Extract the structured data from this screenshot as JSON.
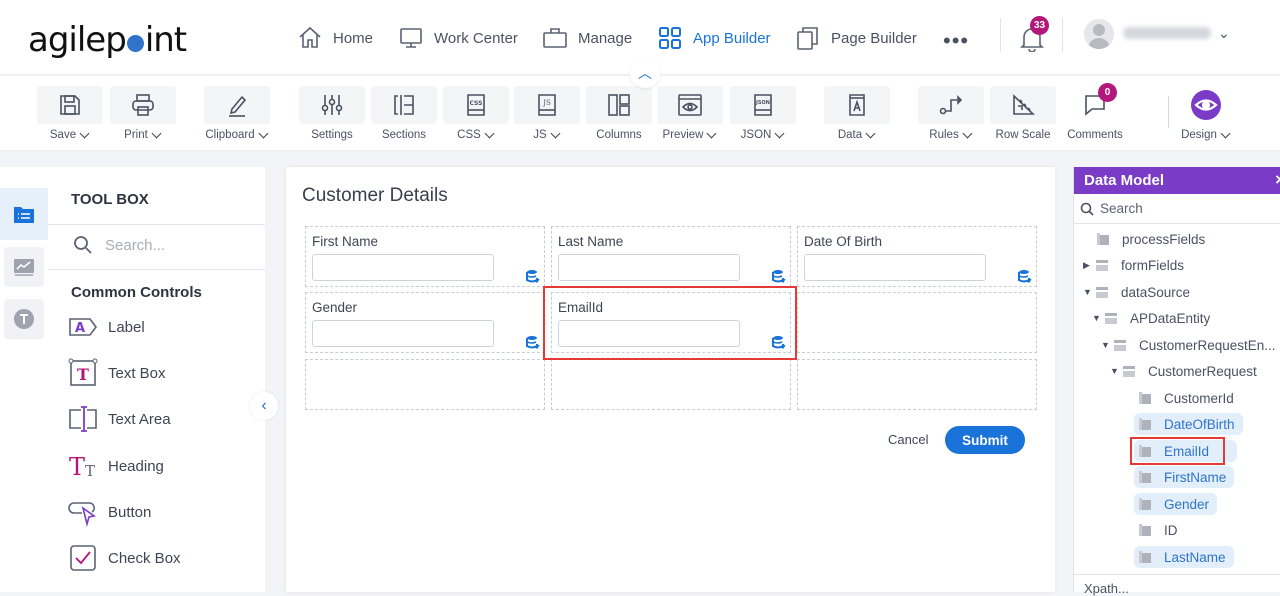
{
  "brand": {
    "logo_pre": "agilep",
    "logo_post": "int"
  },
  "nav": {
    "items": [
      {
        "label": "Home",
        "icon": "home-icon"
      },
      {
        "label": "Work Center",
        "icon": "monitor-icon"
      },
      {
        "label": "Manage",
        "icon": "briefcase-icon"
      },
      {
        "label": "App Builder",
        "icon": "grid-icon",
        "active": true
      },
      {
        "label": "Page Builder",
        "icon": "pages-icon"
      }
    ],
    "more": "•••",
    "notifications_count": "33",
    "user_chevron": "⌄"
  },
  "toolbar": {
    "items": [
      {
        "label": "Save",
        "dropdown": true
      },
      {
        "label": "Print",
        "dropdown": true
      },
      {
        "label": "Clipboard",
        "dropdown": true
      },
      {
        "label": "Settings",
        "dropdown": false
      },
      {
        "label": "Sections",
        "dropdown": false
      },
      {
        "label": "CSS",
        "dropdown": true
      },
      {
        "label": "JS",
        "dropdown": true
      },
      {
        "label": "Columns",
        "dropdown": false
      },
      {
        "label": "Preview",
        "dropdown": true
      },
      {
        "label": "JSON",
        "dropdown": true
      },
      {
        "label": "Data",
        "dropdown": true
      },
      {
        "label": "Rules",
        "dropdown": true
      },
      {
        "label": "Row Scale",
        "dropdown": false
      },
      {
        "label": "Comments",
        "dropdown": false
      },
      {
        "label": "Design",
        "dropdown": true
      }
    ],
    "comments_count": "0"
  },
  "toolbox": {
    "title": "TOOL BOX",
    "search_placeholder": "Search...",
    "group": "Common Controls",
    "items": [
      "Label",
      "Text Box",
      "Text Area",
      "Heading",
      "Button",
      "Check Box"
    ]
  },
  "form": {
    "title": "Customer Details",
    "fields": [
      {
        "label": "First Name",
        "value": ""
      },
      {
        "label": "Last Name",
        "value": ""
      },
      {
        "label": "Date Of Birth",
        "value": ""
      },
      {
        "label": "Gender",
        "value": ""
      },
      {
        "label": "EmailId",
        "value": ""
      }
    ],
    "cancel_label": "Cancel",
    "submit_label": "Submit",
    "accent": "#1a73d9",
    "highlight": "#e53935"
  },
  "data_model": {
    "title": "Data Model",
    "close": "×",
    "search_placeholder": "Search",
    "tree": [
      {
        "label": "processFields",
        "type": "leaf-root"
      },
      {
        "label": "formFields",
        "type": "collapsed"
      },
      {
        "label": "dataSource",
        "type": "expanded"
      },
      {
        "label": "APDataEntity",
        "type": "expanded"
      },
      {
        "label": "CustomerRequestEn...",
        "type": "expanded"
      },
      {
        "label": "CustomerRequest",
        "type": "expanded"
      },
      {
        "label": "CustomerId",
        "type": "leaf"
      },
      {
        "label": "DateOfBirth",
        "type": "leaf",
        "bound": true
      },
      {
        "label": "EmailId",
        "type": "leaf",
        "bound": true,
        "highlighted": true
      },
      {
        "label": "FirstName",
        "type": "leaf",
        "bound": true
      },
      {
        "label": "Gender",
        "type": "leaf",
        "bound": true
      },
      {
        "label": "ID",
        "type": "leaf"
      },
      {
        "label": "LastName",
        "type": "leaf",
        "bound": true
      }
    ],
    "xpath_placeholder": "Xpath...",
    "header_color": "#7a3cc7"
  }
}
